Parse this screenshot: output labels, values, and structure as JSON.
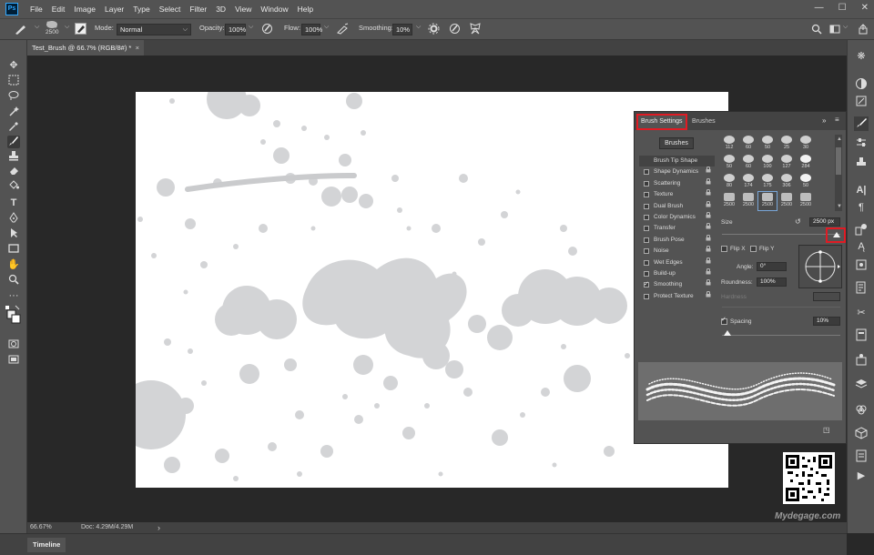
{
  "menubar": {
    "logo": "Ps",
    "items": [
      "File",
      "Edit",
      "Image",
      "Layer",
      "Type",
      "Select",
      "Filter",
      "3D",
      "View",
      "Window",
      "Help"
    ],
    "controls": {
      "minimize": "—",
      "maximize": "☐",
      "close": "✕"
    }
  },
  "options_bar": {
    "brush_size": "2500",
    "mode_label": "Mode:",
    "mode_value": "Normal",
    "opacity_label": "Opacity:",
    "opacity_value": "100%",
    "flow_label": "Flow:",
    "flow_value": "100%",
    "smoothing_label": "Smoothing:",
    "smoothing_value": "10%"
  },
  "document": {
    "tab_title": "Test_Brush @ 66.7% (RGB/8#) *",
    "close": "×"
  },
  "status": {
    "zoom": "66.67%",
    "doc": "Doc: 4.29M/4.29M",
    "arrow": "›"
  },
  "timeline": {
    "label": "Timeline"
  },
  "brush_panel": {
    "tabs": [
      "Brush Settings",
      "Brushes"
    ],
    "brushes_button": "Brushes",
    "options": [
      {
        "label": "Brush Tip Shape",
        "checkbox": false,
        "checked": false,
        "lock": false,
        "selected": true
      },
      {
        "label": "Shape Dynamics",
        "checkbox": true,
        "checked": false,
        "lock": true
      },
      {
        "label": "Scattering",
        "checkbox": true,
        "checked": false,
        "lock": true
      },
      {
        "label": "Texture",
        "checkbox": true,
        "checked": false,
        "lock": true
      },
      {
        "label": "Dual Brush",
        "checkbox": true,
        "checked": false,
        "lock": true
      },
      {
        "label": "Color Dynamics",
        "checkbox": true,
        "checked": false,
        "lock": true
      },
      {
        "label": "Transfer",
        "checkbox": true,
        "checked": false,
        "lock": true
      },
      {
        "label": "Brush Pose",
        "checkbox": true,
        "checked": false,
        "lock": true
      },
      {
        "label": "Noise",
        "checkbox": true,
        "checked": false,
        "lock": true
      },
      {
        "label": "Wet Edges",
        "checkbox": true,
        "checked": false,
        "lock": true
      },
      {
        "label": "Build-up",
        "checkbox": true,
        "checked": false,
        "lock": true
      },
      {
        "label": "Smoothing",
        "checkbox": true,
        "checked": true,
        "lock": true
      },
      {
        "label": "Protect Texture",
        "checkbox": true,
        "checked": false,
        "lock": true
      }
    ],
    "tip_sizes": [
      "112",
      "60",
      "50",
      "25",
      "30",
      "50",
      "60",
      "100",
      "127",
      "284",
      "80",
      "174",
      "175",
      "306",
      "50",
      "2500",
      "2500",
      "2500",
      "2500",
      "2500"
    ],
    "selected_tip_index": 17,
    "size_label": "Size",
    "size_value": "2500 px",
    "flip_x": "Flip X",
    "flip_y": "Flip Y",
    "angle_label": "Angle:",
    "angle_value": "0°",
    "roundness_label": "Roundness:",
    "roundness_value": "100%",
    "hardness_label": "Hardness",
    "spacing_label": "Spacing",
    "spacing_value": "10%",
    "spacing_checked": true
  },
  "watermark": {
    "text": "Mydegage.com"
  },
  "colors": {
    "highlight": "#e01b24",
    "splatter": "#d3d4d6",
    "panel": "#535353"
  }
}
